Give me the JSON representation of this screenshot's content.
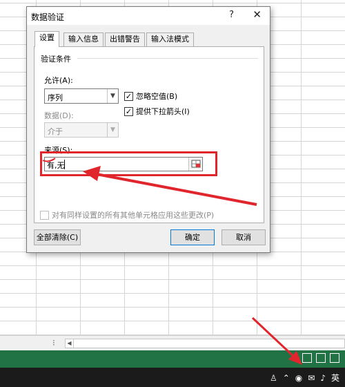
{
  "dialog": {
    "title": "数据验证",
    "help_label": "?",
    "close_label": "✕"
  },
  "tabs": [
    {
      "label": "设置",
      "active": true
    },
    {
      "label": "输入信息"
    },
    {
      "label": "出错警告"
    },
    {
      "label": "输入法模式"
    }
  ],
  "settings": {
    "group_label": "验证条件",
    "allow_label": "允许(A):",
    "allow_value": "序列",
    "ignore_blank_label": "忽略空值(B)",
    "ignore_blank_checked": true,
    "dropdown_label": "提供下拉箭头(I)",
    "dropdown_checked": true,
    "data_label": "数据(D):",
    "data_value": "介于",
    "source_label": "来源(S):",
    "source_value": "有,无",
    "apply_all_label": "对有同样设置的所有其他单元格应用这些更改(P)",
    "apply_all_checked": false
  },
  "buttons": {
    "clear_all": "全部清除(C)",
    "ok": "确定",
    "cancel": "取消"
  },
  "taskbar": {
    "ime_label": "英"
  },
  "colors": {
    "annotation_red": "#e0262c",
    "excel_green": "#217346"
  }
}
